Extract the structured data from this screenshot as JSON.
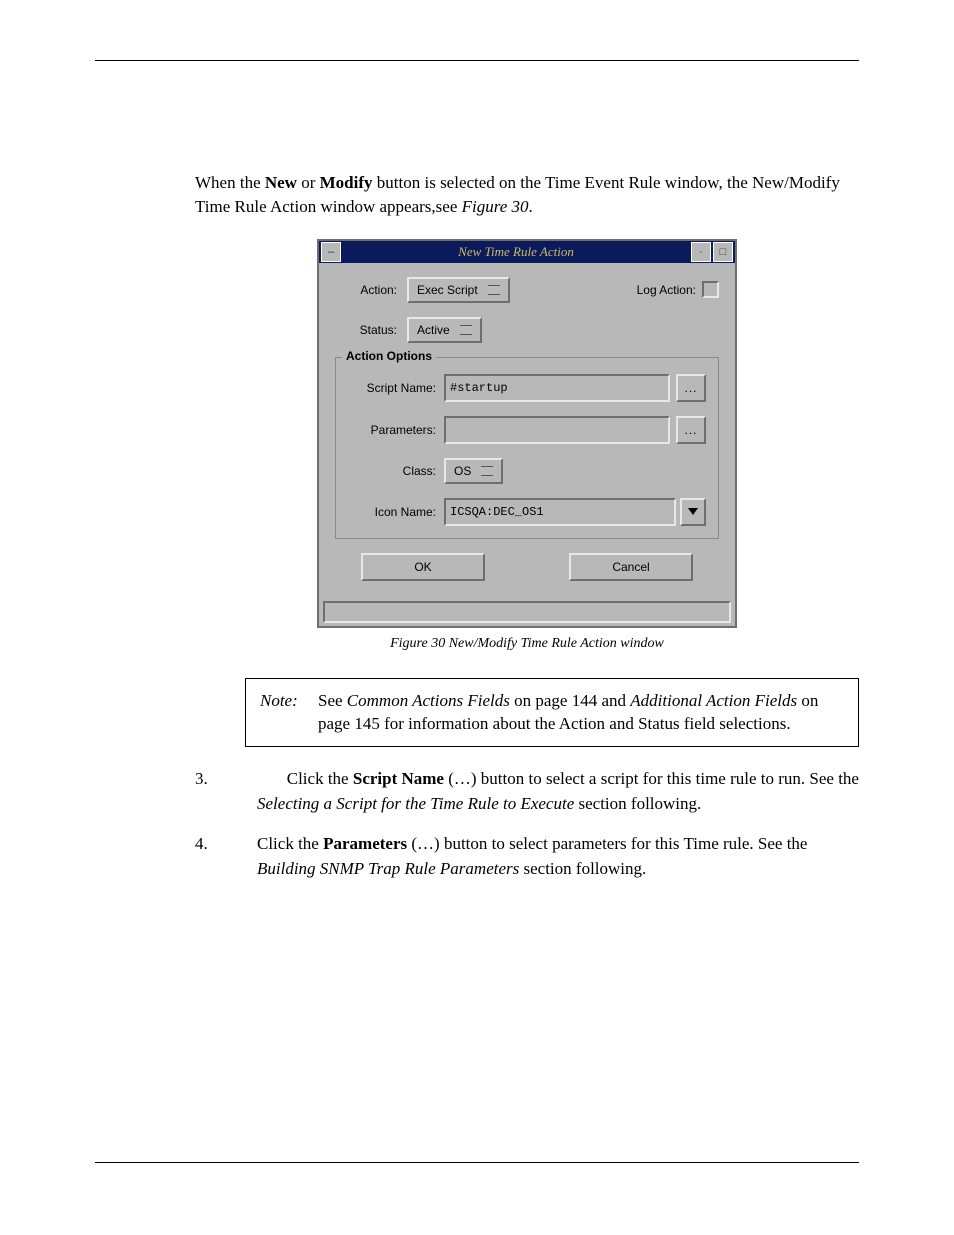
{
  "intro": {
    "prefix": "When the ",
    "new": "New",
    "or": " or ",
    "modify": "Modify",
    "mid": " button is selected on the Time Event Rule window, the New/Modify Time Rule Action window appears,see ",
    "figref": "Figure 30",
    "suffix": "."
  },
  "dialog": {
    "title": "New Time Rule Action",
    "action_label": "Action:",
    "action_value": "Exec Script",
    "logaction_label": "Log Action:",
    "status_label": "Status:",
    "status_value": "Active",
    "fieldset_legend": "Action Options",
    "scriptname_label": "Script Name:",
    "scriptname_value": "#startup",
    "parameters_label": "Parameters:",
    "parameters_value": "",
    "class_label": "Class:",
    "class_value": "OS",
    "iconname_label": "Icon Name:",
    "iconname_value": "ICSQA:DEC_OS1",
    "ok_label": "OK",
    "cancel_label": "Cancel",
    "ellipsis": "..."
  },
  "figcap": "Figure 30 New/Modify Time Rule Action window",
  "note": {
    "label": "Note:",
    "t1": "See ",
    "i1": "Common Actions Fields",
    "t2": " on page 144 and ",
    "i2": "Additional Action Fields",
    "t3": " on page 145 for information about the Action and Status field selections."
  },
  "step3": {
    "num": "3.",
    "t1": "Click the ",
    "b1": "Script Name",
    "t2": " (…) button to select a script for this time rule to run. See the ",
    "i1": "Selecting a Script for the Time Rule to Execute",
    "t3": " section following."
  },
  "step4": {
    "num": "4.",
    "t1": "Click the ",
    "b1": "Parameters",
    "t2": " (…) button to select parameters for this Time rule. See the ",
    "i1": "Building SNMP Trap Rule Parameters",
    "t3": " section following."
  }
}
